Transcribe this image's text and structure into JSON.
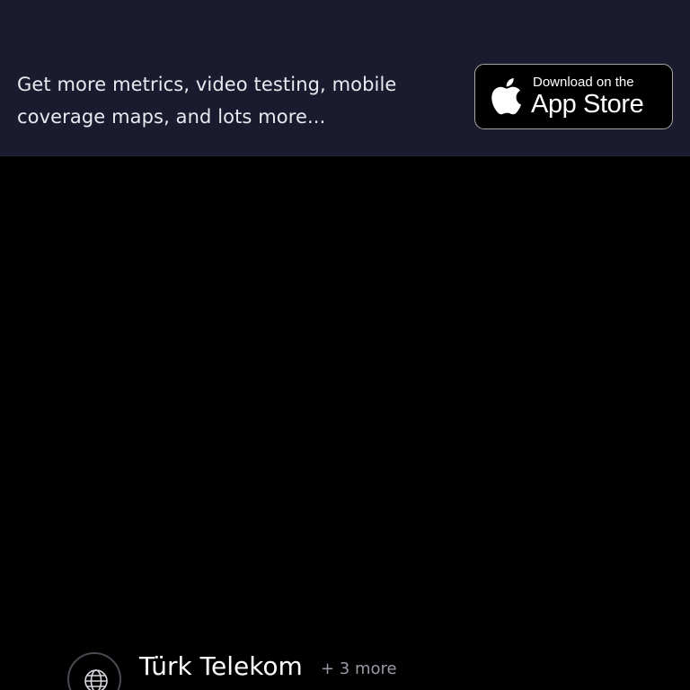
{
  "promo": {
    "line1": "Get more metrics, video testing, mobile",
    "line2": "coverage maps, and lots more...",
    "badge": {
      "small_text": "Download on the",
      "large_text": "App Store",
      "icon": "apple-icon"
    }
  },
  "provider": {
    "name": "Türk Telekom",
    "more": "+ 3 more",
    "icon": "globe-icon"
  },
  "colors": {
    "banner_bg": "#1a1b2e",
    "page_bg": "#000000",
    "text_primary": "#ffffff",
    "text_secondary": "#9a9aa6",
    "badge_border": "#a6a6a6"
  }
}
